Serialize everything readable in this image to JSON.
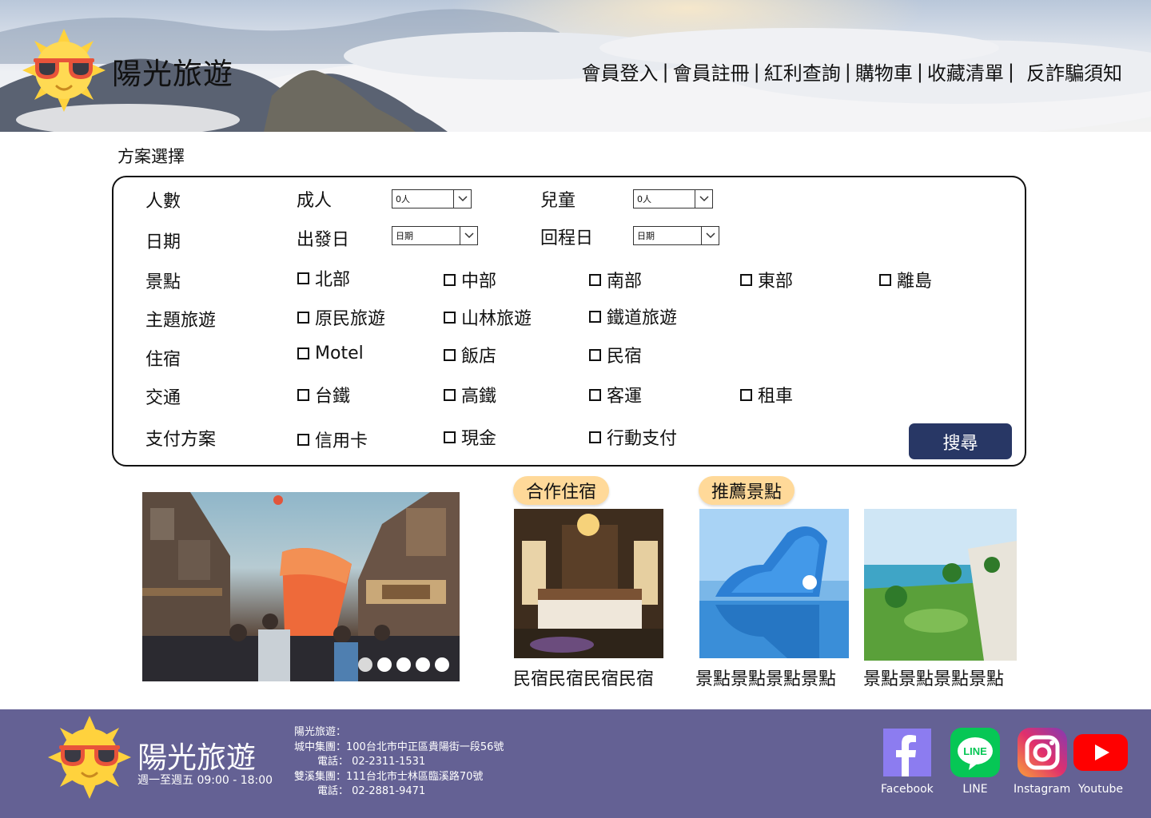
{
  "brand": {
    "name": "陽光旅遊"
  },
  "nav": {
    "items": [
      "會員登入",
      "會員註冊",
      "紅利查詢",
      "購物車",
      "收藏清單",
      "反詐騙須知"
    ],
    "separator": "|"
  },
  "plan": {
    "title": "方案選擇",
    "people": {
      "label": "人數",
      "adult_label": "成人",
      "adult_value": "0人",
      "child_label": "兒童",
      "child_value": "0人"
    },
    "date": {
      "label": "日期",
      "depart_label": "出發日",
      "depart_value": "日期",
      "return_label": "回程日",
      "return_value": "日期"
    },
    "attractions": {
      "label": "景點",
      "options": [
        "北部",
        "中部",
        "南部",
        "東部",
        "離島"
      ]
    },
    "themes": {
      "label": "主題旅遊",
      "options": [
        "原民旅遊",
        "山林旅遊",
        "鐵道旅遊"
      ]
    },
    "lodging": {
      "label": "住宿",
      "options": [
        "Motel",
        "飯店",
        "民宿"
      ]
    },
    "transport": {
      "label": "交通",
      "options": [
        "台鐵",
        "高鐵",
        "客運",
        "租車"
      ]
    },
    "payment": {
      "label": "支付方案",
      "options": [
        "信用卡",
        "現金",
        "行動支付"
      ]
    },
    "search_label": "搜尋"
  },
  "carousel": {
    "slide_count": 5,
    "active_index": 0
  },
  "partner": {
    "tag": "合作住宿",
    "items": [
      {
        "caption": "民宿民宿民宿民宿"
      }
    ]
  },
  "recommend": {
    "tag": "推薦景點",
    "items": [
      {
        "caption": "景點景點景點景點"
      },
      {
        "caption": "景點景點景點景點"
      }
    ]
  },
  "footer": {
    "brand": "陽光旅遊",
    "hours": "週一至週五 09:00 - 18:00",
    "company": "陽光旅遊：",
    "branch1": "城中集團：100台北市中正區貴陽街一段56號",
    "phone1": "電話： 02-2311-1531",
    "branch2": "雙溪集團：111台北市士林區臨溪路70號",
    "phone2": "電話： 02-2881-9471",
    "social": [
      {
        "name": "Facebook",
        "icon": "facebook-icon",
        "color": "#8c7cf0"
      },
      {
        "name": "LINE",
        "icon": "line-icon",
        "color": "#06c755"
      },
      {
        "name": "Instagram",
        "icon": "instagram-icon",
        "color": "#d6297a"
      },
      {
        "name": "Youtube",
        "icon": "youtube-icon",
        "color": "#ff0000"
      }
    ]
  },
  "colors": {
    "accent": "#283765",
    "footer_bg": "#646194",
    "tag_bg": "#ffd999",
    "sun": "#ffd23d",
    "glasses": "#e8533a"
  }
}
